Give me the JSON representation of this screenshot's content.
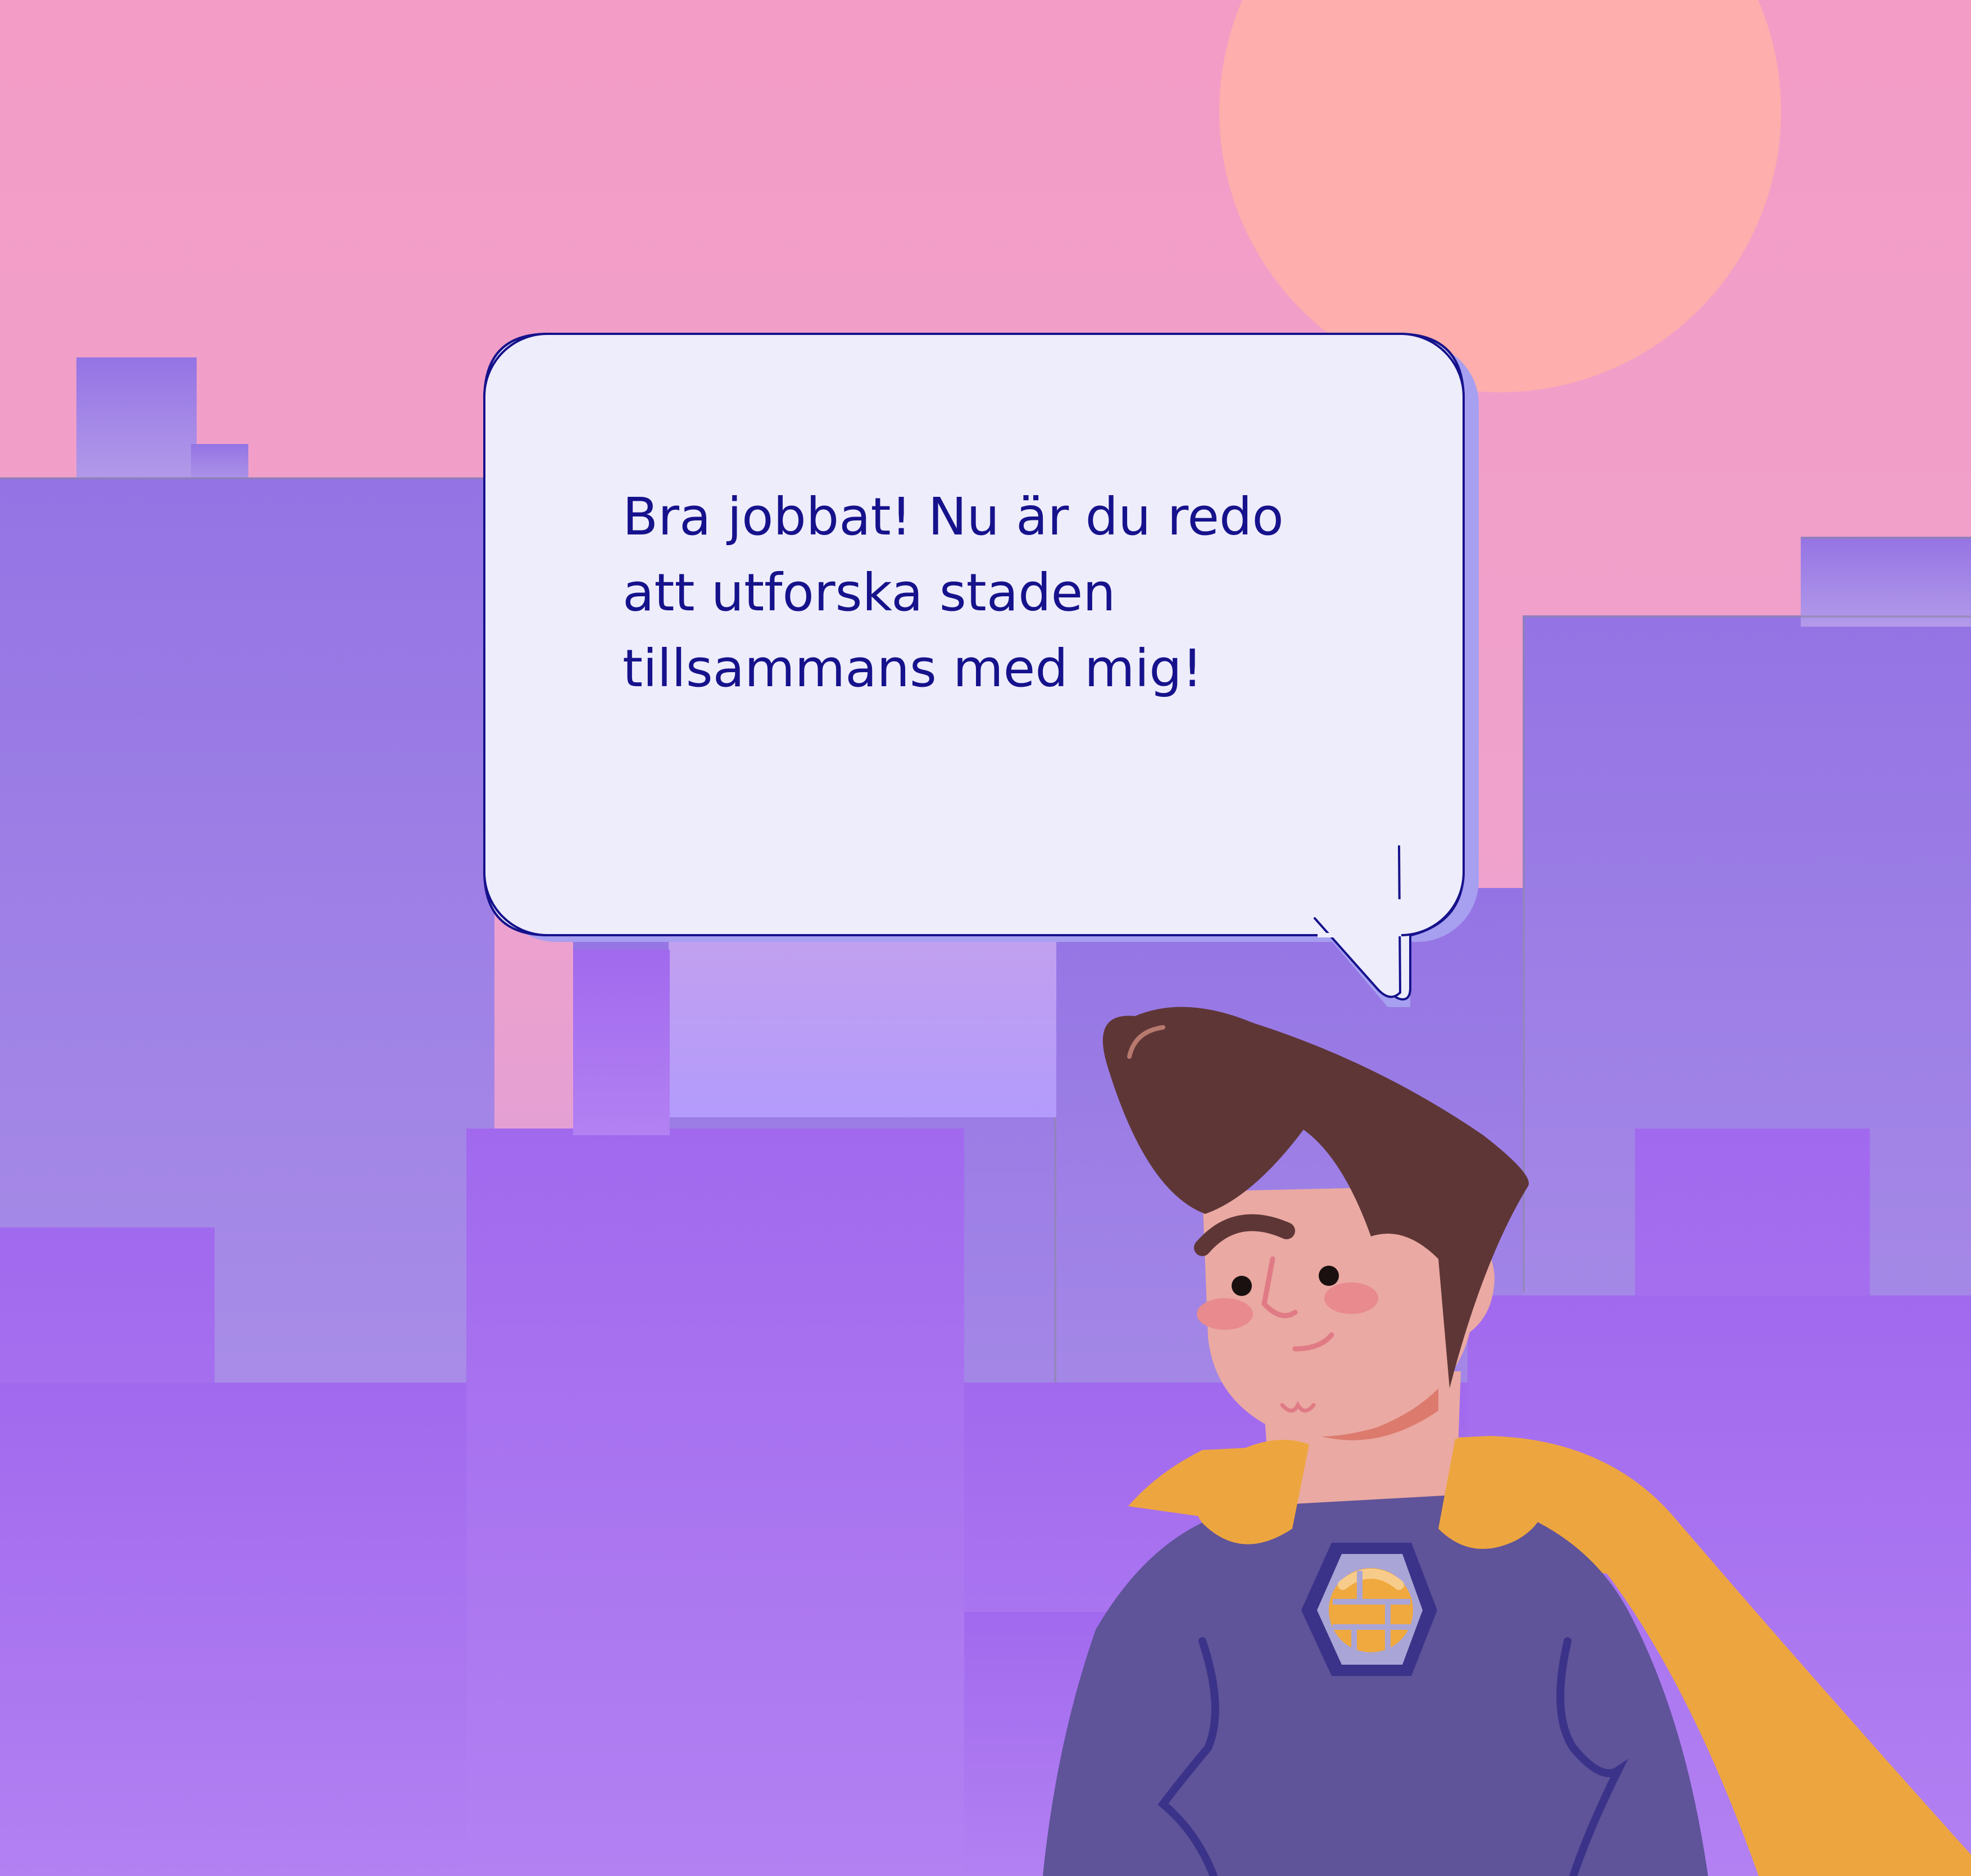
{
  "speech_bubble": {
    "lines": [
      "Bra jobbat! Nu är du redo",
      "att utforska staden",
      "tillsammans med mig!"
    ]
  },
  "colors": {
    "sky": "#f29cc6",
    "sun": "#fdaead",
    "building_far": "#9b74e6",
    "building_mid": "#a56ded",
    "building_glow": "#b89cf5",
    "bubble_fill": "#eeedfb",
    "bubble_border": "#16128c",
    "bubble_shadow": "#a79ff0",
    "hair": "#5e3636",
    "skin": "#eaa9a2",
    "cheek": "#e88a8e",
    "suit": "#5f5399",
    "cape": "#eda63f",
    "badge": "#f0a93f",
    "text": "#16128c"
  },
  "icons": {
    "character": "superhero-boy-icon",
    "badge": "hexagon-emblem-icon",
    "sun": "sun-icon"
  }
}
